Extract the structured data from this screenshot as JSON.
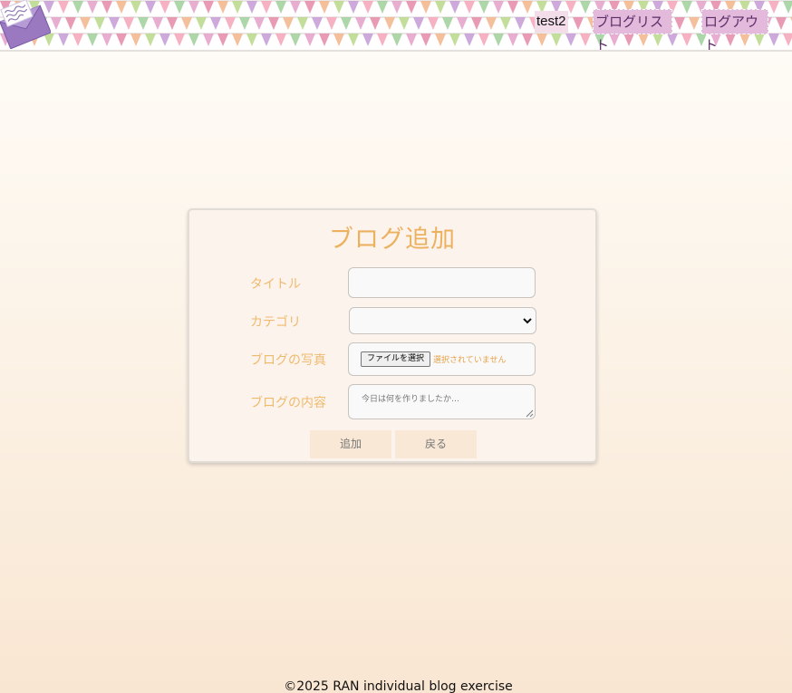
{
  "header": {
    "user_name": "test2",
    "nav": {
      "bloglist_label": "ブログリスト",
      "logout_label": "ログアウト"
    },
    "colors": {
      "nav_link_bg": "#e3b9dc",
      "nav_user_bg": "#f2dde9"
    },
    "icons": {
      "logo": "letter-envelope-icon"
    }
  },
  "form": {
    "title": "ブログ追加",
    "fields": {
      "title_label": "タイトル",
      "title_value": "",
      "category_label": "カテゴリ",
      "category_value": "",
      "photo_label": "ブログの写真",
      "photo_button": "ファイルを選択",
      "photo_status": "選択されていません",
      "content_label": "ブログの内容",
      "content_placeholder": "今日は何を作りましたか…"
    },
    "buttons": {
      "add_label": "追加",
      "back_label": "戻る"
    },
    "colors": {
      "accent": "#ecb15f",
      "button_bg": "#f9e8d6"
    }
  },
  "footer": {
    "text": "©2025 RAN individual  blog exercise"
  }
}
